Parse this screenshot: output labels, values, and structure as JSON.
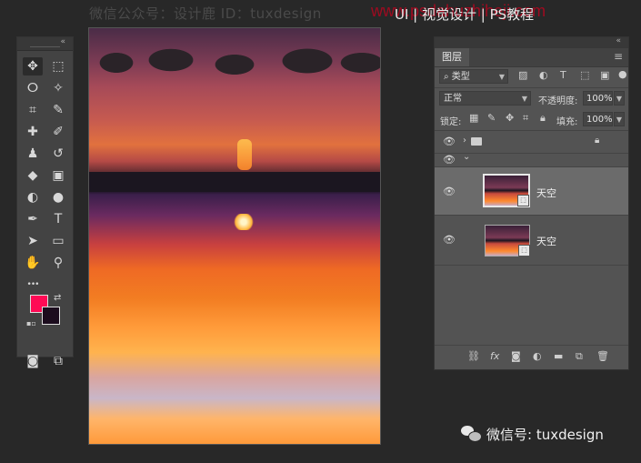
{
  "watermarks": {
    "top_left": "微信公众号：设计鹿 ID：tuxdesign",
    "top_url": "www.psdahuzhiheji.com",
    "top_title": "UI | 视觉设计 | PS教程",
    "bottom_right": "微信号: tuxdesign"
  },
  "tools_panel": {
    "collapse_glyph": "«",
    "tools": [
      {
        "name": "move-tool-icon",
        "glyph": "✥",
        "active": true
      },
      {
        "name": "marquee-tool-icon",
        "glyph": "⬚"
      },
      {
        "name": "lasso-tool-icon",
        "glyph": "ⵔ"
      },
      {
        "name": "magic-wand-tool-icon",
        "glyph": "✧"
      },
      {
        "name": "crop-tool-icon",
        "glyph": "⌗"
      },
      {
        "name": "eyedropper-tool-icon",
        "glyph": "✎"
      },
      {
        "name": "healing-brush-tool-icon",
        "glyph": "✚"
      },
      {
        "name": "brush-tool-icon",
        "glyph": "✐"
      },
      {
        "name": "clone-stamp-tool-icon",
        "glyph": "♟"
      },
      {
        "name": "history-brush-tool-icon",
        "glyph": "↺"
      },
      {
        "name": "eraser-tool-icon",
        "glyph": "◆"
      },
      {
        "name": "gradient-tool-icon",
        "glyph": "▣"
      },
      {
        "name": "blur-tool-icon",
        "glyph": "◐"
      },
      {
        "name": "dodge-tool-icon",
        "glyph": "●"
      },
      {
        "name": "pen-tool-icon",
        "glyph": "✒"
      },
      {
        "name": "type-tool-icon",
        "glyph": "T"
      },
      {
        "name": "path-selection-tool-icon",
        "glyph": "➤"
      },
      {
        "name": "shape-tool-icon",
        "glyph": "▭"
      },
      {
        "name": "hand-tool-icon",
        "glyph": "✋"
      },
      {
        "name": "zoom-tool-icon",
        "glyph": "⚲"
      },
      {
        "name": "more-tools-icon",
        "glyph": "•••"
      },
      {
        "name": "quick-mask-icon",
        "glyph": "◙"
      },
      {
        "name": "screen-mode-icon",
        "glyph": "⧉"
      }
    ],
    "foreground_color": "#ff0a55",
    "background_color": "#1c0d1e"
  },
  "layers_panel": {
    "collapse_glyph": "«",
    "tab_label": "图层",
    "menu_glyph": "≡",
    "filter_select": "类型",
    "blend_mode": "正常",
    "opacity_label": "不透明度:",
    "opacity_value": "100%",
    "lock_label": "锁定:",
    "fill_label": "填充:",
    "fill_value": "100%",
    "layers": [
      {
        "type": "group",
        "expanded": false,
        "name": ""
      },
      {
        "type": "group",
        "expanded": true,
        "name": ""
      },
      {
        "type": "layer",
        "name": "天空",
        "selected": true
      },
      {
        "type": "layer",
        "name": "天空",
        "selected": false
      }
    ]
  }
}
